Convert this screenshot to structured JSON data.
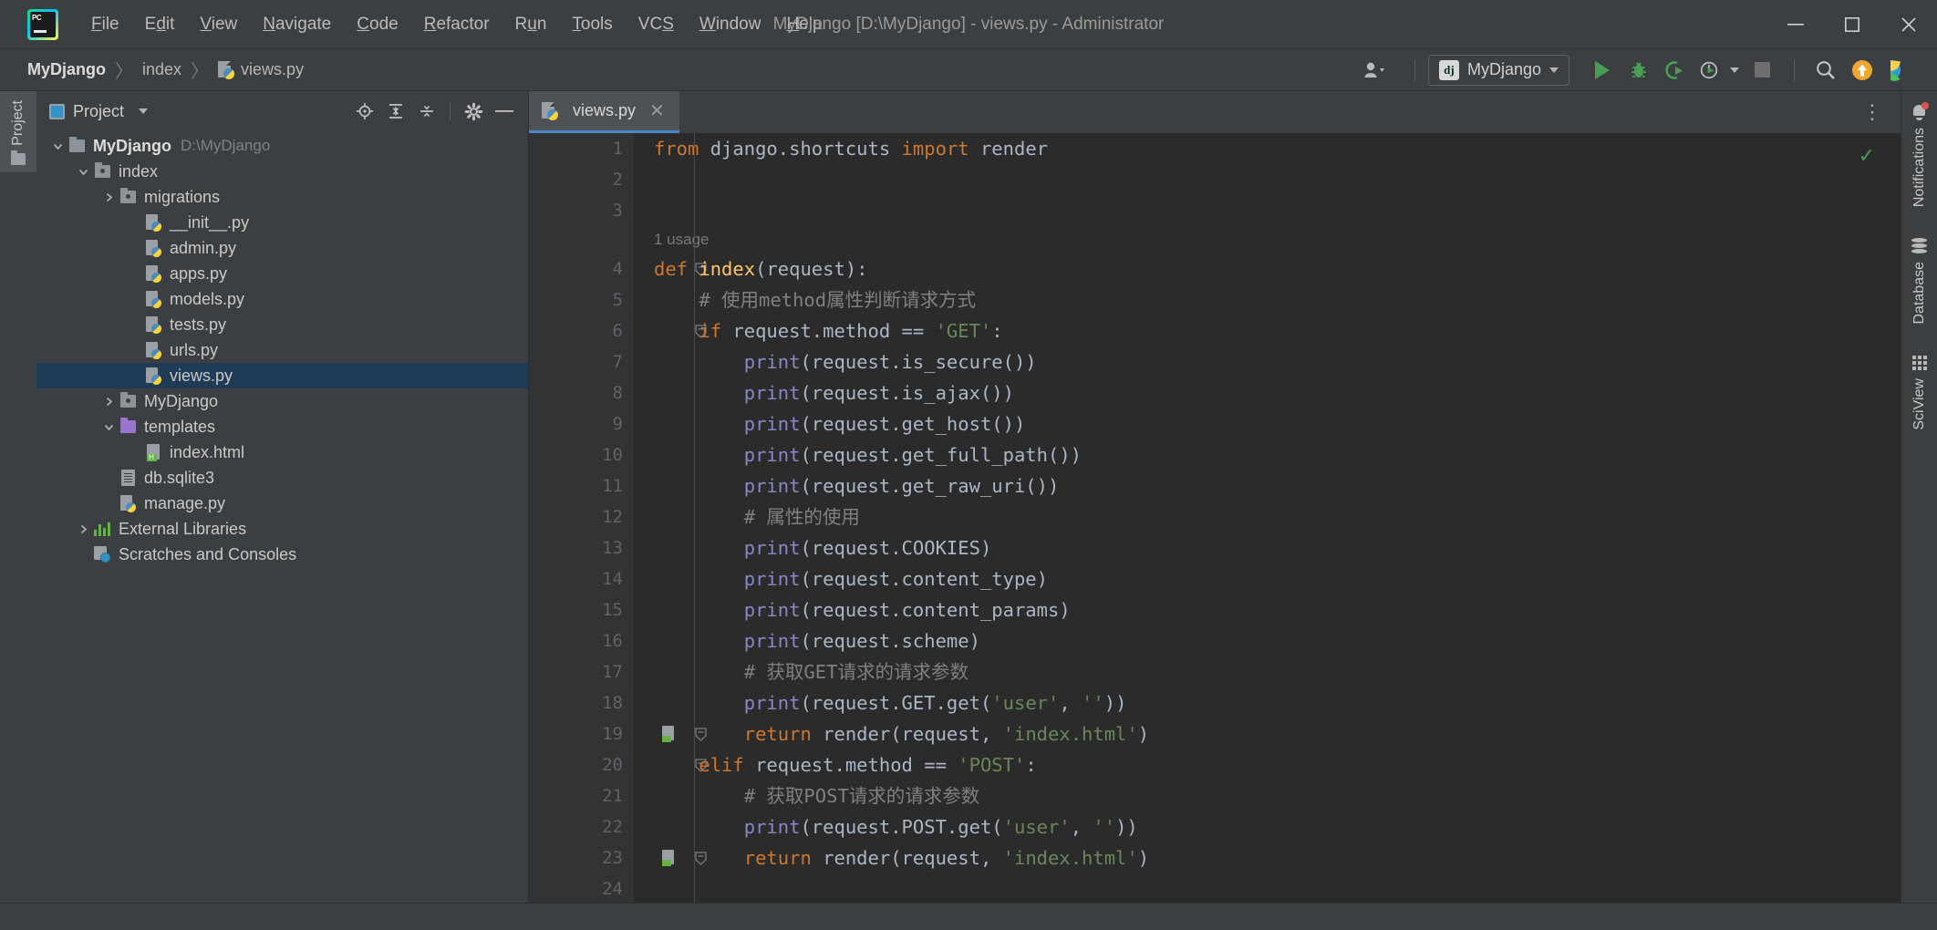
{
  "window": {
    "title": "MyDjango [D:\\MyDjango] - views.py - Administrator",
    "minimize_label": "─",
    "maximize_label": "☐",
    "close_label": "✕"
  },
  "menu": {
    "items": [
      {
        "label": "File"
      },
      {
        "label": "Edit"
      },
      {
        "label": "View"
      },
      {
        "label": "Navigate"
      },
      {
        "label": "Code"
      },
      {
        "label": "Refactor"
      },
      {
        "label": "Run"
      },
      {
        "label": "Tools"
      },
      {
        "label": "VCS"
      },
      {
        "label": "Window"
      },
      {
        "label": "Help"
      }
    ]
  },
  "breadcrumb": {
    "project": "MyDjango",
    "folder": "index",
    "file": "views.py",
    "separator": "〉"
  },
  "toolbar": {
    "run_config_name": "MyDjango",
    "run_config_badge": "dj",
    "icons": [
      "user-avatar-icon",
      "run-icon",
      "debug-icon",
      "run-coverage-icon",
      "profile-icon",
      "stop-icon",
      "search-everywhere-icon",
      "update-project-icon",
      "ide-helper-icon"
    ]
  },
  "left_rail": {
    "project_tab_label": "Project"
  },
  "project_panel": {
    "title": "Project",
    "actions": [
      "locate-icon",
      "expand-all-icon",
      "collapse-all-icon",
      "settings-gear-icon",
      "hide-icon"
    ],
    "tree": [
      {
        "label": "MyDjango",
        "path": "D:\\MyDjango",
        "icon": "folder-icon",
        "indent": 0,
        "twisty": "expanded",
        "bold": true,
        "selected": false
      },
      {
        "label": "index",
        "path": "",
        "icon": "source-folder-icon",
        "indent": 1,
        "twisty": "expanded",
        "bold": false,
        "selected": false
      },
      {
        "label": "migrations",
        "path": "",
        "icon": "source-folder-icon",
        "indent": 2,
        "twisty": "collapsed",
        "bold": false,
        "selected": false
      },
      {
        "label": "__init__.py",
        "path": "",
        "icon": "python-file-icon",
        "indent": 3,
        "twisty": "none",
        "bold": false,
        "selected": false
      },
      {
        "label": "admin.py",
        "path": "",
        "icon": "python-file-icon",
        "indent": 3,
        "twisty": "none",
        "bold": false,
        "selected": false
      },
      {
        "label": "apps.py",
        "path": "",
        "icon": "python-file-icon",
        "indent": 3,
        "twisty": "none",
        "bold": false,
        "selected": false
      },
      {
        "label": "models.py",
        "path": "",
        "icon": "python-file-icon",
        "indent": 3,
        "twisty": "none",
        "bold": false,
        "selected": false
      },
      {
        "label": "tests.py",
        "path": "",
        "icon": "python-file-icon",
        "indent": 3,
        "twisty": "none",
        "bold": false,
        "selected": false
      },
      {
        "label": "urls.py",
        "path": "",
        "icon": "python-file-icon",
        "indent": 3,
        "twisty": "none",
        "bold": false,
        "selected": false
      },
      {
        "label": "views.py",
        "path": "",
        "icon": "python-file-icon",
        "indent": 3,
        "twisty": "none",
        "bold": false,
        "selected": true
      },
      {
        "label": "MyDjango",
        "path": "",
        "icon": "source-folder-icon",
        "indent": 2,
        "twisty": "collapsed",
        "bold": false,
        "selected": false
      },
      {
        "label": "templates",
        "path": "",
        "icon": "template-folder-icon",
        "indent": 2,
        "twisty": "expanded",
        "bold": false,
        "selected": false
      },
      {
        "label": "index.html",
        "path": "",
        "icon": "html-file-icon",
        "indent": 3,
        "twisty": "none",
        "bold": false,
        "selected": false
      },
      {
        "label": "db.sqlite3",
        "path": "",
        "icon": "file-icon",
        "indent": 2,
        "twisty": "none",
        "bold": false,
        "selected": false
      },
      {
        "label": "manage.py",
        "path": "",
        "icon": "python-file-icon",
        "indent": 2,
        "twisty": "none",
        "bold": false,
        "selected": false
      },
      {
        "label": "External Libraries",
        "path": "",
        "icon": "library-icon",
        "indent": 1,
        "twisty": "collapsed",
        "bold": false,
        "selected": false
      },
      {
        "label": "Scratches and Consoles",
        "path": "",
        "icon": "scratch-icon",
        "indent": 1,
        "twisty": "none",
        "bold": false,
        "selected": false
      }
    ]
  },
  "editor": {
    "tab_label": "views.py",
    "tab_close_label": "✕",
    "usage_hint": "1 usage",
    "inspection_status": "✓",
    "lines": [
      {
        "no": "1",
        "tokens": [
          {
            "t": "from ",
            "c": "k"
          },
          {
            "t": "django.shortcuts ",
            "c": "n"
          },
          {
            "t": "import ",
            "c": "k"
          },
          {
            "t": "render",
            "c": "n"
          }
        ]
      },
      {
        "no": "2",
        "tokens": []
      },
      {
        "no": "3",
        "tokens": []
      },
      {
        "no": "4",
        "fold": true,
        "tokens": [
          {
            "t": "def ",
            "c": "k"
          },
          {
            "t": "index",
            "c": "fn"
          },
          {
            "t": "(request):",
            "c": "n"
          }
        ]
      },
      {
        "no": "5",
        "tokens": [
          {
            "t": "    # 使用method属性判断请求方式",
            "c": "cm"
          }
        ]
      },
      {
        "no": "6",
        "fold": true,
        "tokens": [
          {
            "t": "    ",
            "c": "n"
          },
          {
            "t": "if ",
            "c": "k"
          },
          {
            "t": "request.method == ",
            "c": "n"
          },
          {
            "t": "'GET'",
            "c": "s"
          },
          {
            "t": ":",
            "c": "n"
          }
        ]
      },
      {
        "no": "7",
        "tokens": [
          {
            "t": "        ",
            "c": "n"
          },
          {
            "t": "print",
            "c": "b"
          },
          {
            "t": "(request.is_secure())",
            "c": "n"
          }
        ]
      },
      {
        "no": "8",
        "tokens": [
          {
            "t": "        ",
            "c": "n"
          },
          {
            "t": "print",
            "c": "b"
          },
          {
            "t": "(request.is_ajax())",
            "c": "n"
          }
        ]
      },
      {
        "no": "9",
        "tokens": [
          {
            "t": "        ",
            "c": "n"
          },
          {
            "t": "print",
            "c": "b"
          },
          {
            "t": "(request.get_host())",
            "c": "n"
          }
        ]
      },
      {
        "no": "10",
        "tokens": [
          {
            "t": "        ",
            "c": "n"
          },
          {
            "t": "print",
            "c": "b"
          },
          {
            "t": "(request.get_full_path())",
            "c": "n"
          }
        ]
      },
      {
        "no": "11",
        "tokens": [
          {
            "t": "        ",
            "c": "n"
          },
          {
            "t": "print",
            "c": "b"
          },
          {
            "t": "(request.get_raw_uri())",
            "c": "n"
          }
        ]
      },
      {
        "no": "12",
        "tokens": [
          {
            "t": "        # 属性的使用",
            "c": "cm"
          }
        ]
      },
      {
        "no": "13",
        "tokens": [
          {
            "t": "        ",
            "c": "n"
          },
          {
            "t": "print",
            "c": "b"
          },
          {
            "t": "(request.COOKIES)",
            "c": "n"
          }
        ]
      },
      {
        "no": "14",
        "tokens": [
          {
            "t": "        ",
            "c": "n"
          },
          {
            "t": "print",
            "c": "b"
          },
          {
            "t": "(request.content_type)",
            "c": "n"
          }
        ]
      },
      {
        "no": "15",
        "tokens": [
          {
            "t": "        ",
            "c": "n"
          },
          {
            "t": "print",
            "c": "b"
          },
          {
            "t": "(request.content_params)",
            "c": "n"
          }
        ]
      },
      {
        "no": "16",
        "tokens": [
          {
            "t": "        ",
            "c": "n"
          },
          {
            "t": "print",
            "c": "b"
          },
          {
            "t": "(request.scheme)",
            "c": "n"
          }
        ]
      },
      {
        "no": "17",
        "tokens": [
          {
            "t": "        # 获取GET请求的请求参数",
            "c": "cm"
          }
        ]
      },
      {
        "no": "18",
        "tokens": [
          {
            "t": "        ",
            "c": "n"
          },
          {
            "t": "print",
            "c": "b"
          },
          {
            "t": "(request.GET.get(",
            "c": "n"
          },
          {
            "t": "'user'",
            "c": "s"
          },
          {
            "t": ", ",
            "c": "n"
          },
          {
            "t": "''",
            "c": "s"
          },
          {
            "t": "))",
            "c": "n"
          }
        ]
      },
      {
        "no": "19",
        "gutter_icon": "html-file-icon",
        "fold": true,
        "tokens": [
          {
            "t": "        ",
            "c": "n"
          },
          {
            "t": "return ",
            "c": "k"
          },
          {
            "t": "render(request, ",
            "c": "n"
          },
          {
            "t": "'index.html'",
            "c": "s"
          },
          {
            "t": ")",
            "c": "n"
          }
        ]
      },
      {
        "no": "20",
        "fold": true,
        "tokens": [
          {
            "t": "    ",
            "c": "n"
          },
          {
            "t": "elif ",
            "c": "k"
          },
          {
            "t": "request.method == ",
            "c": "n"
          },
          {
            "t": "'POST'",
            "c": "s"
          },
          {
            "t": ":",
            "c": "n"
          }
        ]
      },
      {
        "no": "21",
        "tokens": [
          {
            "t": "        # 获取POST请求的请求参数",
            "c": "cm"
          }
        ]
      },
      {
        "no": "22",
        "tokens": [
          {
            "t": "        ",
            "c": "n"
          },
          {
            "t": "print",
            "c": "b"
          },
          {
            "t": "(request.POST.get(",
            "c": "n"
          },
          {
            "t": "'user'",
            "c": "s"
          },
          {
            "t": ", ",
            "c": "n"
          },
          {
            "t": "''",
            "c": "s"
          },
          {
            "t": "))",
            "c": "n"
          }
        ]
      },
      {
        "no": "23",
        "gutter_icon": "html-file-icon",
        "fold": true,
        "tokens": [
          {
            "t": "        ",
            "c": "n"
          },
          {
            "t": "return ",
            "c": "k"
          },
          {
            "t": "render(request, ",
            "c": "n"
          },
          {
            "t": "'index.html'",
            "c": "s"
          },
          {
            "t": ")",
            "c": "n"
          }
        ]
      },
      {
        "no": "24",
        "tokens": []
      }
    ]
  },
  "right_rail": {
    "items": [
      {
        "label": "Notifications",
        "icon": "bell-icon",
        "badge": true
      },
      {
        "label": "Database",
        "icon": "database-icon",
        "badge": false
      },
      {
        "label": "SciView",
        "icon": "grid-icon",
        "badge": false
      }
    ]
  },
  "colors": {
    "accent": "#4a88c7",
    "selection": "#1f3b56",
    "run_green": "#499c54",
    "keyword": "#cc7832",
    "string": "#6a8759",
    "comment": "#808080",
    "function": "#ffc66d",
    "builtin": "#8888c6",
    "editor_bg": "#2b2b2b",
    "panel_bg": "#3c3f41"
  }
}
